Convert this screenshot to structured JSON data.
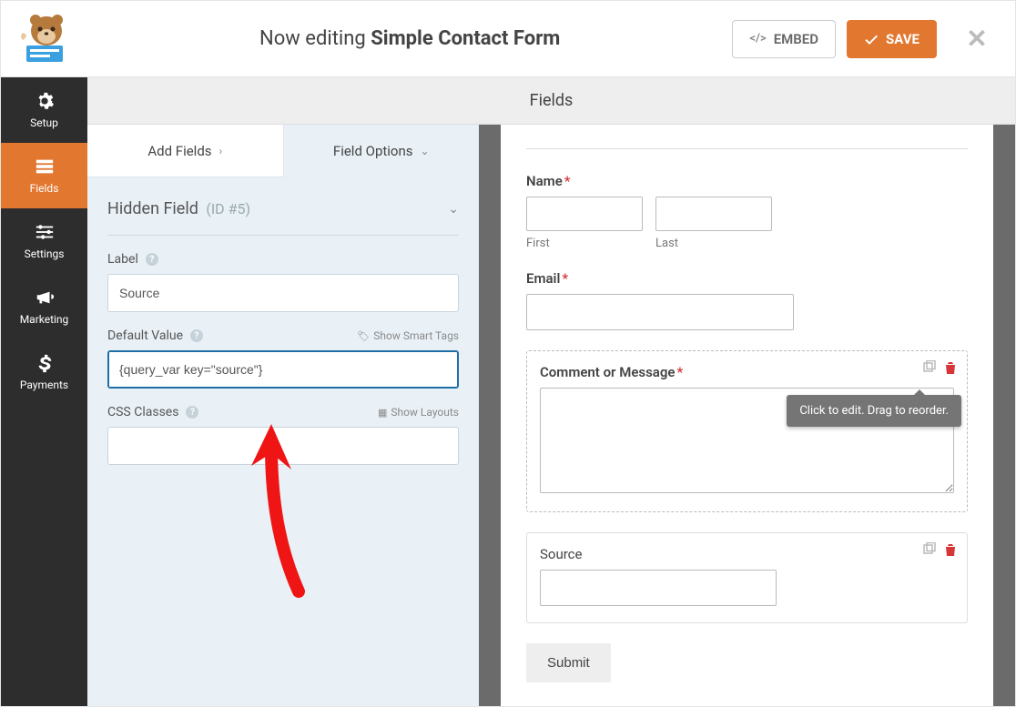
{
  "header": {
    "editing_prefix": "Now editing ",
    "form_name": "Simple Contact Form",
    "embed_label": "EMBED",
    "save_label": "SAVE"
  },
  "sidebar": {
    "items": [
      {
        "label": "Setup"
      },
      {
        "label": "Fields"
      },
      {
        "label": "Settings"
      },
      {
        "label": "Marketing"
      },
      {
        "label": "Payments"
      }
    ]
  },
  "panel": {
    "header": "Fields",
    "tabs": {
      "add": "Add Fields",
      "options": "Field Options"
    },
    "section": {
      "title": "Hidden Field",
      "id_text": "(ID #5)"
    },
    "labels": {
      "label": "Label",
      "default_value": "Default Value",
      "show_smart_tags": "Show Smart Tags",
      "css_classes": "CSS Classes",
      "show_layouts": "Show Layouts"
    },
    "values": {
      "label": "Source",
      "default_value": "{query_var key=\"source\"}",
      "css_classes": ""
    }
  },
  "preview": {
    "name_label": "Name",
    "first": "First",
    "last": "Last",
    "email_label": "Email",
    "comment_label": "Comment or Message",
    "tooltip": "Click to edit. Drag to reorder.",
    "source_label": "Source",
    "submit_label": "Submit"
  }
}
